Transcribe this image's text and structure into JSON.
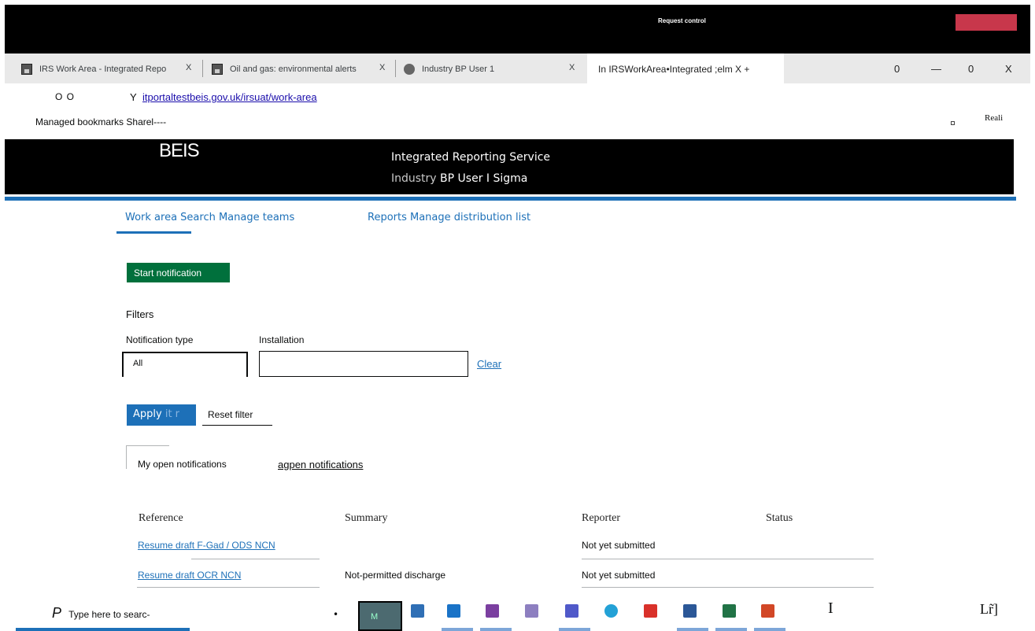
{
  "browser": {
    "request_control": "Request control",
    "tabs": [
      {
        "label": "IRS Work Area - Integrated Repo"
      },
      {
        "label": "Oil and gas: environmental alerts"
      },
      {
        "label": "Industry BP User 1"
      }
    ],
    "tab_close": "X",
    "active_tab": "In IRSWorkArea•Integrated ;elm X +",
    "window_controls": [
      "0",
      "—",
      "0",
      "X"
    ],
    "nav_buttons": "O O",
    "url_prefix": "Y",
    "url": "itportaltestbeis.gov.uk/irsuat/work-area",
    "bookmarks": "Managed bookmarks Sharel----",
    "reading_list": "Reali"
  },
  "header": {
    "logo": "BEIS",
    "service_name": "Integrated Reporting Service",
    "user_prefix": "Industry",
    "user_name": "BP User I Sigma"
  },
  "nav": {
    "left": "Work area Search Manage teams",
    "right": "Reports Manage distribution list"
  },
  "actions": {
    "start_notification": "Start notification"
  },
  "filters": {
    "title": "Filters",
    "notification_type_label": "Notification type",
    "notification_type_value": "All",
    "installation_label": "Installation",
    "installation_value": "",
    "clear": "Clear",
    "apply": "Apply",
    "apply_suffix": "it r",
    "reset": "Reset filter"
  },
  "notification_tabs": {
    "my_open": "My open notifications",
    "all_open": "agpen notifications"
  },
  "table": {
    "headers": [
      "Reference",
      "Summary",
      "Reporter",
      "Status"
    ],
    "rows": [
      {
        "reference": "Resume draft F-Gad / ODS NCN",
        "summary": "",
        "reporter": "Not yet submitted",
        "status": ""
      },
      {
        "reference": "Resume draft OCR NCN",
        "summary": "Not-permitted discharge",
        "reporter": "Not yet submitted",
        "status": ""
      }
    ]
  },
  "taskbar": {
    "search_glyph": "P",
    "search_text": "Type here to searc-",
    "dot": "•",
    "app_letter": "M",
    "cursor": "I",
    "tray": "Lr̃]"
  },
  "colors": {
    "green_button": "#00703c",
    "link_blue": "#1d70b8",
    "header_black": "#000000",
    "red_block": "#c8374b"
  }
}
